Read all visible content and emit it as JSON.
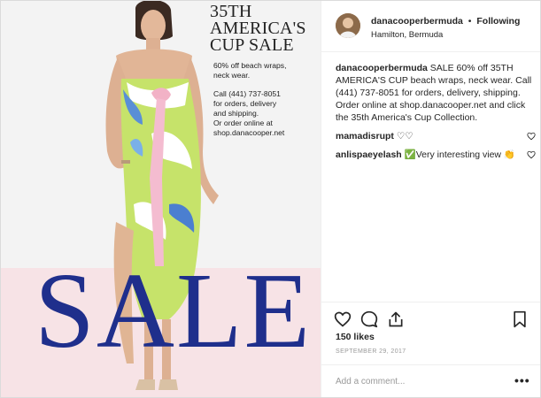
{
  "post": {
    "username": "danacooperbermuda",
    "separator": "•",
    "follow_status": "Following",
    "location": "Hamilton, Bermuda",
    "caption_user": "danacooperbermuda",
    "caption_text": "SALE 60% off 35TH AMERICA'S CUP beach wraps, neck wear. Call (441) 737-8051 for orders, delivery, shipping. Order online at shop.danacooper.net and click the 35th America's Cup Collection.",
    "comments": [
      {
        "user": "mamadisrupt",
        "text": "♡♡"
      },
      {
        "user": "anlispaeyelash",
        "text": "✅Very interesting view 👏"
      }
    ],
    "likes": "150 likes",
    "date": "SEPTEMBER 29, 2017",
    "add_comment_placeholder": "Add a comment...",
    "more_options": "•••"
  },
  "ad_image": {
    "headline": "35TH\nAMERICA'S\nCUP SALE",
    "offer": "60% off beach wraps,\nneck wear.",
    "contact": "Call (441) 737-8051\nfor orders, delivery\nand shipping.\nOr order online at\nshop.danacooper.net",
    "sale_word": "SALE"
  },
  "colors": {
    "sale_text": "#1f2f8c",
    "pink_band": "#f7e3e6",
    "like_count_text": "#262626",
    "muted": "#999999"
  },
  "icons": [
    "heart-icon",
    "comment-icon",
    "share-icon",
    "bookmark-icon",
    "small-heart-icon",
    "more-options-icon"
  ]
}
